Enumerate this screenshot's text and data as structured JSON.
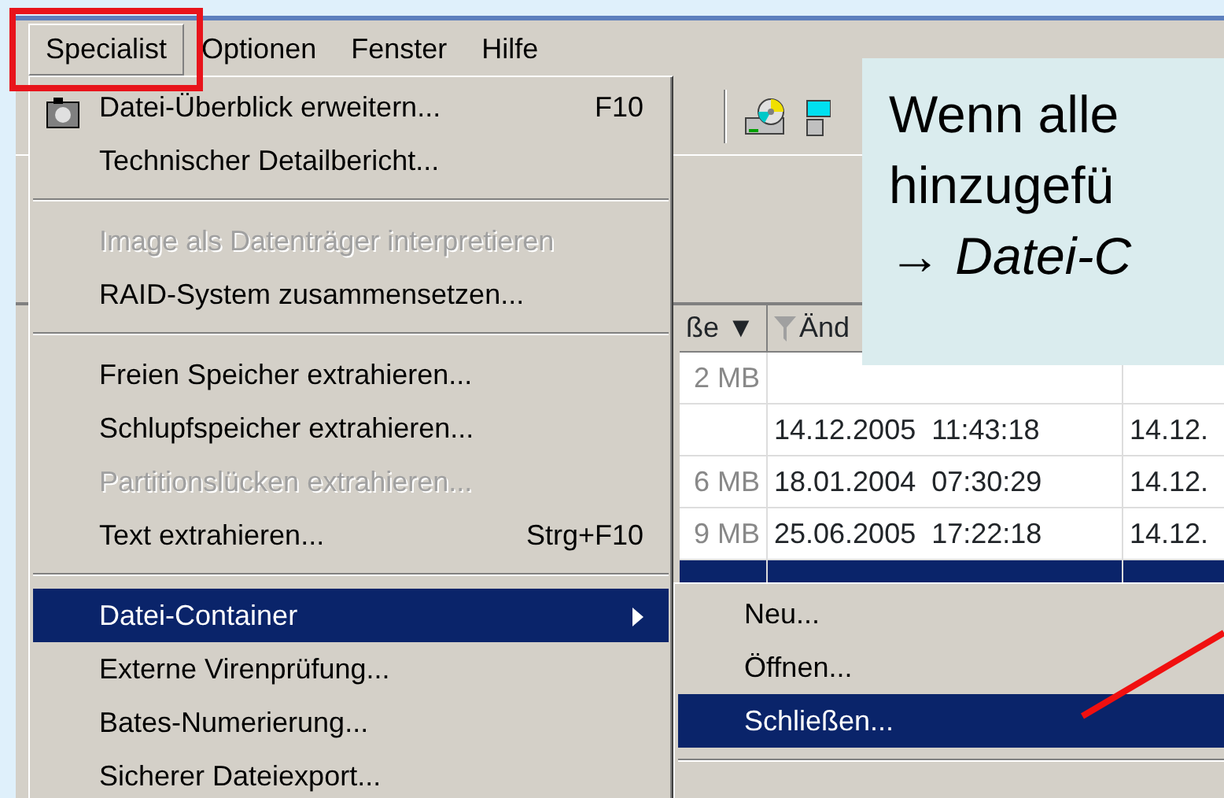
{
  "menubar": [
    {
      "label": "Specialist",
      "selected": true,
      "highlighted": true
    },
    {
      "label": "Optionen",
      "selected": false,
      "highlighted": false
    },
    {
      "label": "Fenster",
      "selected": false,
      "highlighted": false
    },
    {
      "label": "Hilfe",
      "selected": false,
      "highlighted": false
    }
  ],
  "menu": [
    {
      "kind": "item",
      "label": "Datei-Überblick erweitern...",
      "shortcut": "F10",
      "icon": true,
      "disabled": false,
      "selected": false
    },
    {
      "kind": "item",
      "label": "Technischer Detailbericht...",
      "disabled": false,
      "selected": false
    },
    {
      "kind": "separator"
    },
    {
      "kind": "item",
      "label": "Image als Datenträger interpretieren",
      "disabled": true,
      "selected": false
    },
    {
      "kind": "item",
      "label": "RAID-System zusammensetzen...",
      "disabled": false,
      "selected": false
    },
    {
      "kind": "separator"
    },
    {
      "kind": "item",
      "label": "Freien Speicher extrahieren...",
      "disabled": false,
      "selected": false
    },
    {
      "kind": "item",
      "label": "Schlupfspeicher extrahieren...",
      "disabled": false,
      "selected": false
    },
    {
      "kind": "item",
      "label": "Partitionslücken extrahieren...",
      "disabled": true,
      "selected": false
    },
    {
      "kind": "item",
      "label": "Text extrahieren...",
      "shortcut": "Strg+F10",
      "disabled": false,
      "selected": false
    },
    {
      "kind": "separator"
    },
    {
      "kind": "item",
      "label": "Datei-Container",
      "submenu": true,
      "disabled": false,
      "selected": true
    },
    {
      "kind": "item",
      "label": "Externe Virenprüfung...",
      "disabled": false,
      "selected": false
    },
    {
      "kind": "item",
      "label": "Bates-Numerierung...",
      "disabled": false,
      "selected": false
    },
    {
      "kind": "item",
      "label": "Sicherer Dateiexport...",
      "disabled": false,
      "selected": false
    }
  ],
  "submenu": [
    {
      "kind": "item",
      "label": "Neu...",
      "selected": false
    },
    {
      "kind": "item",
      "label": "Öffnen...",
      "selected": false
    },
    {
      "kind": "item",
      "label": "Schließen...",
      "selected": true
    },
    {
      "kind": "separator"
    }
  ],
  "table": {
    "columns": [
      "ße ▼",
      "Änd"
    ],
    "rows": [
      {
        "cells": [
          "2 MB",
          "",
          ""
        ],
        "selected": false
      },
      {
        "cells": [
          "",
          "14.12.2005  11:43:18",
          "14.12."
        ],
        "selected": false
      },
      {
        "cells": [
          "6 MB",
          "18.01.2004  07:30:29",
          "14.12."
        ],
        "selected": false
      },
      {
        "cells": [
          "9 MB",
          "25.06.2005  17:22:18",
          "14.12."
        ],
        "selected": false
      },
      {
        "cells": [
          "",
          "",
          ""
        ],
        "selected": true
      }
    ]
  },
  "callout": {
    "lines": [
      "Wenn alle",
      "hinzugefü",
      "→ *Datei-C*"
    ]
  }
}
